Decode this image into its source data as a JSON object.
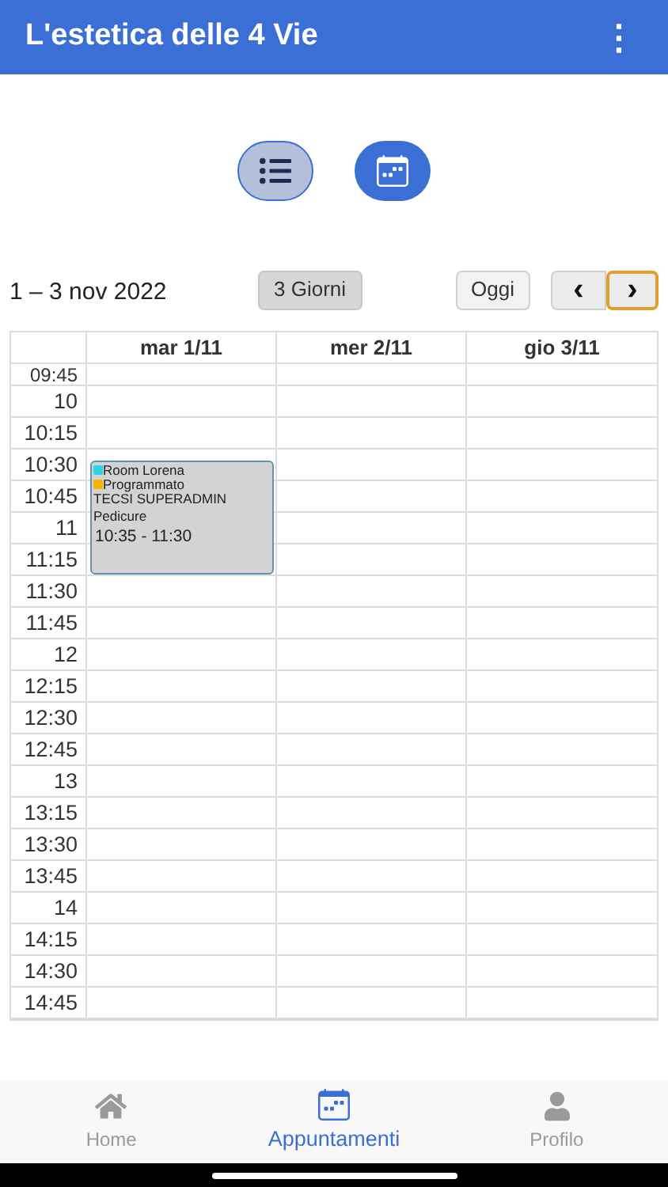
{
  "app_bar": {
    "title": "L'estetica delle 4 Vie",
    "menu_glyph": "⋮"
  },
  "view_toggle": [
    {
      "kind": "list",
      "selected": true
    },
    {
      "kind": "calendar",
      "selected": false
    }
  ],
  "toolbar": {
    "range": "1 – 3 nov 2022",
    "view_button": "3 Giorni",
    "today_button": "Oggi",
    "prev": "‹",
    "next": "›"
  },
  "calendar": {
    "days": [
      "mar 1/11",
      "mer 2/11",
      "gio 3/11"
    ],
    "times": [
      "09:45",
      "10",
      "10:15",
      "10:30",
      "10:45",
      "11",
      "11:15",
      "11:30",
      "11:45",
      "12",
      "12:15",
      "12:30",
      "12:45",
      "13",
      "13:15",
      "13:30",
      "13:45",
      "14",
      "14:15",
      "14:30",
      "14:45"
    ],
    "event": {
      "tags": [
        {
          "label": "Room Lorena",
          "color": "#2dd4e6"
        },
        {
          "label": "Programmato",
          "color": "#f5b400"
        }
      ],
      "client": "TECSI SUPERADMIN",
      "service": "Pedicure",
      "time": "10:35 - 11:30"
    }
  },
  "bottom_nav": [
    {
      "kind": "home",
      "label": "Home",
      "selected": false
    },
    {
      "kind": "calendar",
      "label": "Appuntamenti",
      "selected": true
    },
    {
      "kind": "profile",
      "label": "Profilo",
      "selected": false
    }
  ]
}
